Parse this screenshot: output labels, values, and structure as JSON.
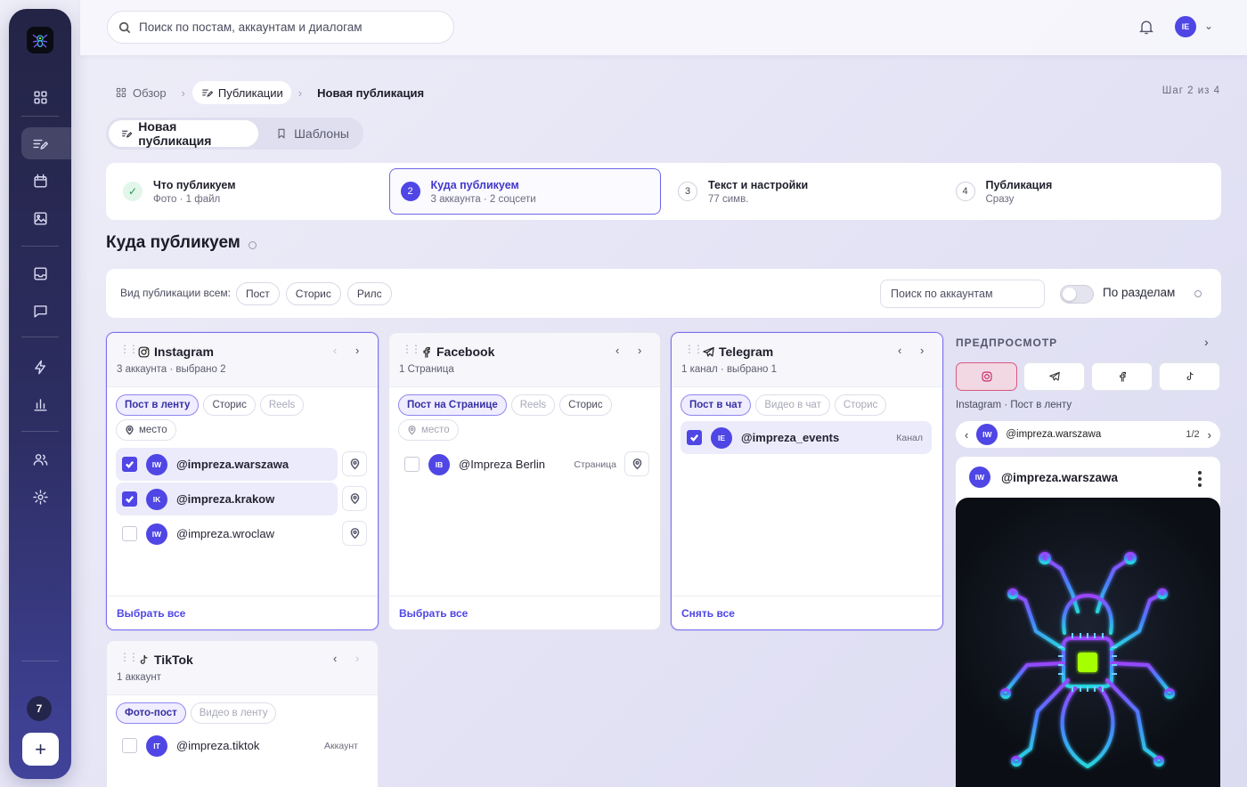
{
  "topbar": {
    "search_placeholder": "Поиск по постам, аккаунтам и диалогам",
    "user_initials": "IE"
  },
  "sidebar": {
    "badge_count": "7",
    "add_label": "+"
  },
  "breadcrumb": [
    "Обзор",
    "Публикации",
    "Новая публикация"
  ],
  "step_counter": "Шаг 2 из 4",
  "tabs": [
    {
      "label": "Новая публикация",
      "active": true
    },
    {
      "label": "Шаблоны",
      "active": false
    }
  ],
  "steps": [
    {
      "num": "✓",
      "title": "Что публикуем",
      "sub": "Фото · 1 файл",
      "state": "done"
    },
    {
      "num": "2",
      "title": "Куда публикуем",
      "sub": "3 аккаунта · 2 соцсети",
      "state": "current"
    },
    {
      "num": "3",
      "title": "Текст и настройки",
      "sub": "77 симв.",
      "state": "todo"
    },
    {
      "num": "4",
      "title": "Публикация",
      "sub": "Сразу",
      "state": "todo"
    }
  ],
  "section_title": "Куда публикуем",
  "filters": {
    "label": "Вид публикации всем:",
    "chips": [
      "Пост",
      "Сторис",
      "Рилс"
    ],
    "account_search_placeholder": "Поиск по аккаунтам",
    "toggle_label": "По разделам",
    "toggle_on": false
  },
  "platforms": {
    "instagram": {
      "name": "Instagram",
      "sub": "3 аккаунта · выбрано 2",
      "formats": [
        "Пост в ленту",
        "Сторис",
        "Reels"
      ],
      "place": "место",
      "accounts": [
        {
          "initials": "IW",
          "name": "@impreza.warszawa",
          "checked": true
        },
        {
          "initials": "IK",
          "name": "@impreza.krakow",
          "checked": true
        },
        {
          "initials": "IW",
          "name": "@impreza.wroclaw",
          "checked": false
        }
      ],
      "footer": "Выбрать все"
    },
    "facebook": {
      "name": "Facebook",
      "sub": "1 Страница",
      "formats": [
        "Пост на Странице",
        "Reels",
        "Сторис"
      ],
      "place": "место",
      "accounts": [
        {
          "initials": "IB",
          "name": "@Impreza Berlin",
          "type": "Страница",
          "checked": false
        }
      ],
      "footer": "Выбрать все"
    },
    "telegram": {
      "name": "Telegram",
      "sub": "1 канал · выбрано 1",
      "formats": [
        "Пост в чат",
        "Видео в чат",
        "Сторис"
      ],
      "accounts": [
        {
          "initials": "IE",
          "name": "@impreza_events",
          "type": "Канал",
          "checked": true
        }
      ],
      "footer": "Снять все"
    },
    "tiktok": {
      "name": "TikTok",
      "sub": "1 аккаунт",
      "formats": [
        "Фото-пост",
        "Видео в ленту"
      ],
      "accounts": [
        {
          "initials": "IT",
          "name": "@impreza.tiktok",
          "type": "Аккаунт",
          "checked": false
        }
      ]
    }
  },
  "preview": {
    "label": "ПРЕДПРОСМОТР",
    "caption": "Instagram · Пост в ленту",
    "account_initials": "IW",
    "account": "@impreza.warszawa",
    "page": "1/2"
  },
  "colors": {
    "accent": "#4f46e5",
    "sidebar": "#2d2e63",
    "chip_green": "#a6ff00",
    "neon_cyan": "#2bd3e6",
    "neon_purple": "#8a4dff"
  }
}
